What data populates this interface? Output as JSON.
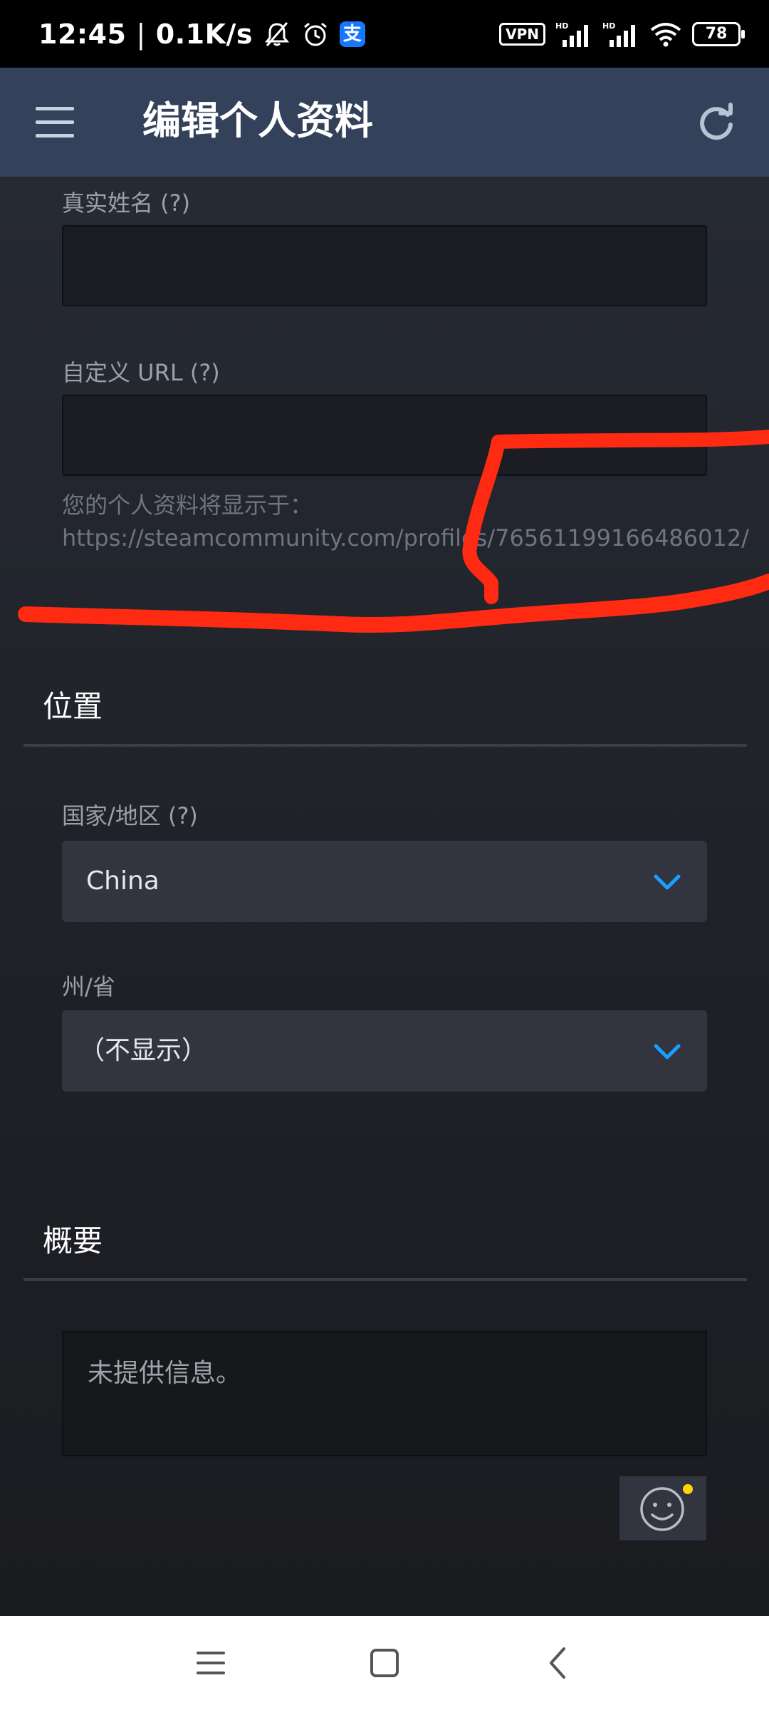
{
  "status_bar": {
    "time": "12:45",
    "speed": "0.1K/s",
    "vpn_label": "VPN",
    "battery_level": "78",
    "alipay_glyph": "支"
  },
  "header": {
    "title": "编辑个人资料"
  },
  "fields": {
    "real_name": {
      "label": "真实姓名 (?)",
      "value": ""
    },
    "custom_url": {
      "label": "自定义 URL (?)",
      "value": "",
      "hint_prefix": "您的个人资料将显示于：",
      "hint_url": "https://steamcommunity.com/profiles/76561199166486012/"
    }
  },
  "location": {
    "section_title": "位置",
    "country": {
      "label": "国家/地区 (?)",
      "selected": "China"
    },
    "state": {
      "label": "州/省",
      "selected": "（不显示）"
    }
  },
  "summary": {
    "section_title": "概要",
    "text": "未提供信息。"
  },
  "colors": {
    "header_bg": "#33415a",
    "accent": "#1a9fff",
    "annotation": "#ff2a12"
  },
  "icons": {
    "menu": "hamburger-icon",
    "refresh": "refresh-icon",
    "emoji": "smiley-icon",
    "nav_recent": "menu-lines-icon",
    "nav_home": "square-icon",
    "nav_back": "chevron-left-icon"
  }
}
